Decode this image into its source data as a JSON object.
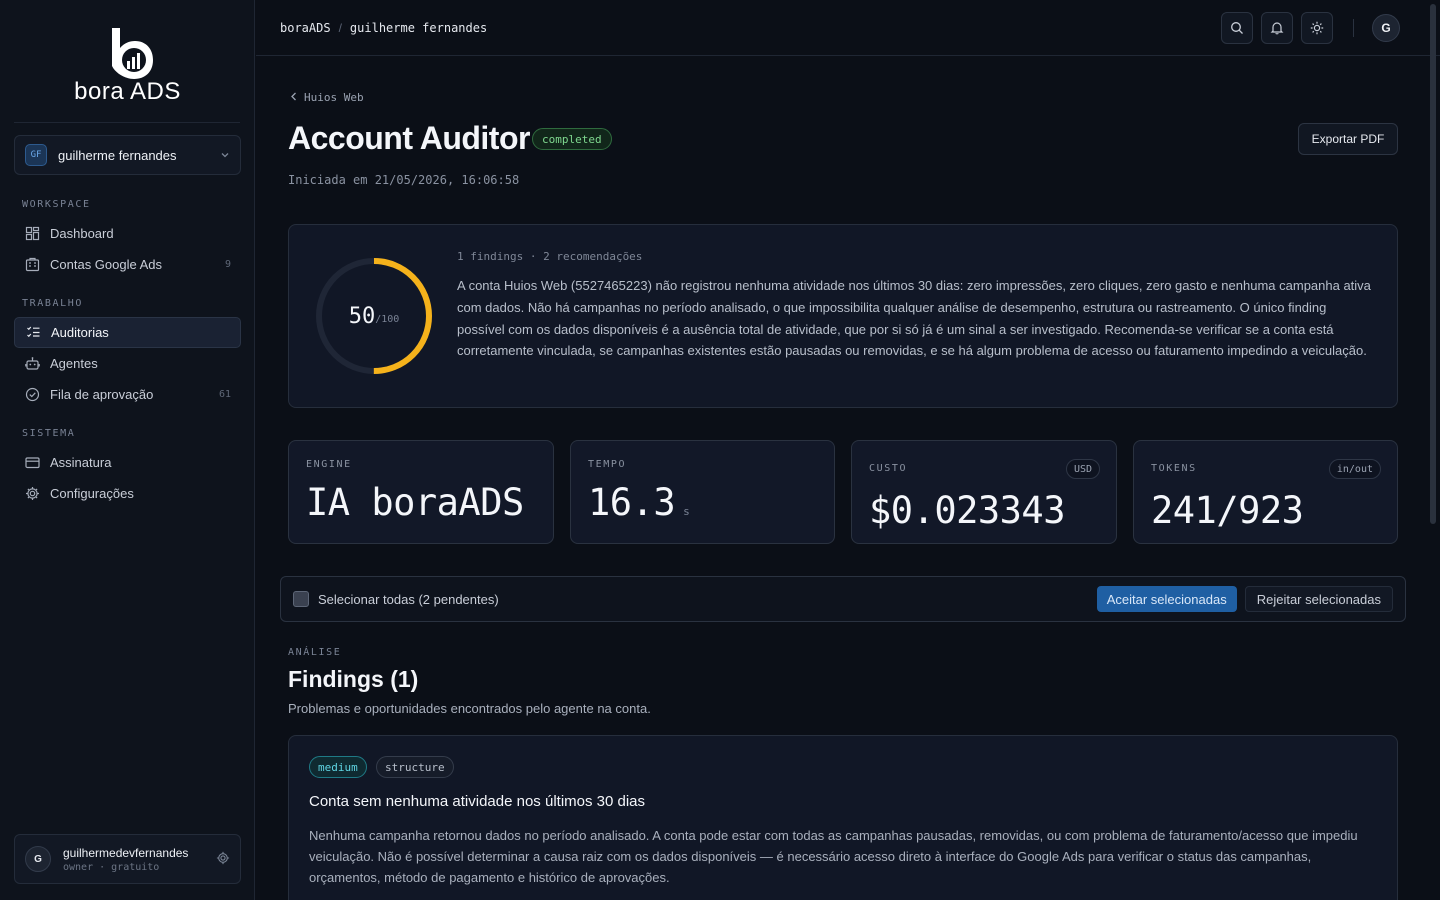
{
  "brand": {
    "name": "bora ADS",
    "logo_letter": "b"
  },
  "workspace": {
    "initials": "GF",
    "name": "guilherme fernandes"
  },
  "sidebar": {
    "sections": [
      {
        "label": "WORKSPACE"
      },
      {
        "label": "TRABALHO"
      },
      {
        "label": "SISTEMA"
      }
    ],
    "items": [
      {
        "label": "Dashboard",
        "icon": "dashboard-icon",
        "count": ""
      },
      {
        "label": "Contas Google Ads",
        "icon": "building-icon",
        "count": "9"
      },
      {
        "label": "Auditorias",
        "icon": "list-check-icon",
        "count": "",
        "active": true
      },
      {
        "label": "Agentes",
        "icon": "robot-icon",
        "count": ""
      },
      {
        "label": "Fila de aprovação",
        "icon": "check-circle-icon",
        "count": "61"
      },
      {
        "label": "Assinatura",
        "icon": "credit-card-icon",
        "count": ""
      },
      {
        "label": "Configurações",
        "icon": "gear-icon",
        "count": ""
      }
    ]
  },
  "user": {
    "initial": "G",
    "name": "guilhermedevfernandes",
    "role": "owner · gratuito"
  },
  "topbar": {
    "breadcrumb": [
      "boraADS",
      "guilherme fernandes"
    ],
    "avatar_initial": "G"
  },
  "page": {
    "back_label": "Huios Web",
    "title": "Account Auditor",
    "status": "completed",
    "export_label": "Exportar PDF",
    "started": "Iniciada em 21/05/2026, 16:06:58"
  },
  "score": {
    "value": "50",
    "max": "/100",
    "fraction": 0.5,
    "meta": "1 findings · 2 recomendações",
    "summary": "A conta Huios Web (5527465223) não registrou nenhuma atividade nos últimos 30 dias: zero impressões, zero cliques, zero gasto e nenhuma campanha ativa com dados. Não há campanhas no período analisado, o que impossibilita qualquer análise de desempenho, estrutura ou rastreamento. O único finding possível com os dados disponíveis é a ausência total de atividade, que por si só já é um sinal a ser investigado. Recomenda-se verificar se a conta está corretamente vinculada, se campanhas existentes estão pausadas ou removidas, e se há algum problema de acesso ou faturamento impedindo a veiculação."
  },
  "stats": [
    {
      "label": "ENGINE",
      "value": "IA boraADS",
      "unit": "",
      "chip": ""
    },
    {
      "label": "TEMPO",
      "value": "16.3",
      "unit": "s",
      "chip": ""
    },
    {
      "label": "CUSTO",
      "value": "$0.023343",
      "unit": "",
      "chip": "USD"
    },
    {
      "label": "TOKENS",
      "value": "241/923",
      "unit": "",
      "chip": "in/out"
    }
  ],
  "selection": {
    "label": "Selecionar todas (2 pendentes)",
    "accept_label": "Aceitar selecionadas",
    "reject_label": "Rejeitar selecionadas"
  },
  "findings_section": {
    "eyebrow": "ANÁLISE",
    "title": "Findings (1)",
    "subtitle": "Problemas e oportunidades encontrados pelo agente na conta.",
    "items": [
      {
        "severity": "medium",
        "category": "structure",
        "title": "Conta sem nenhuma atividade nos últimos 30 dias",
        "body": "Nenhuma campanha retornou dados no período analisado. A conta pode estar com todas as campanhas pausadas, removidas, ou com problema de faturamento/acesso que impediu veiculação. Não é possível determinar a causa raiz com os dados disponíveis — é necessário acesso direto à interface do Google Ads para verificar o status das campanhas, orçamentos, método de pagamento e histórico de aprovações."
      }
    ]
  },
  "colors": {
    "accent": "#1f5fa3",
    "score_ring": "#f5b21b",
    "completed": "#7fd88f",
    "medium": "#5fd4e2"
  }
}
